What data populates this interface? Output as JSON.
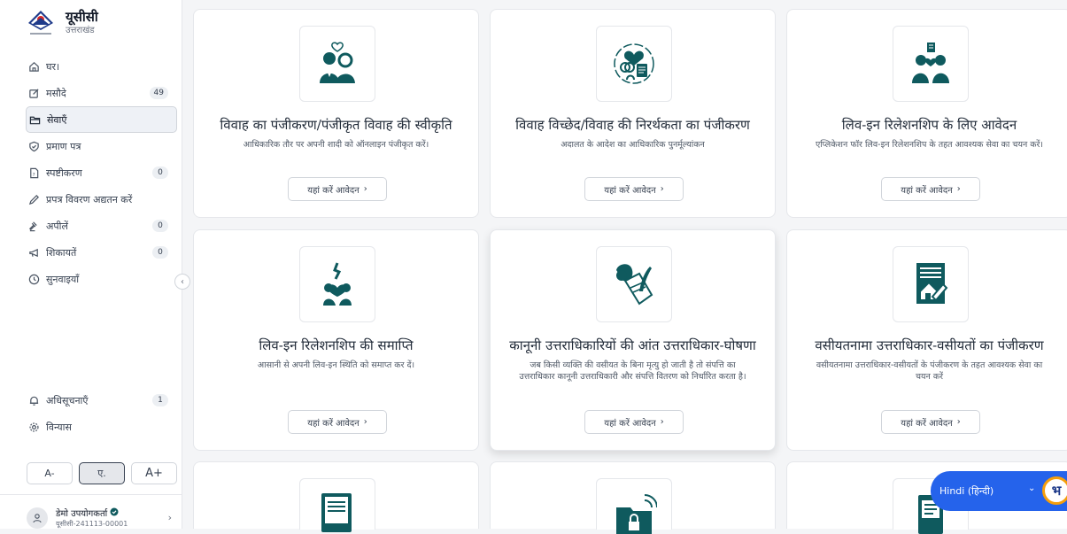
{
  "brand": {
    "title": "यूसीसी",
    "subtitle": "उत्तराखंड",
    "logo_icon": "uttarakhand-emblem-icon"
  },
  "sidebar": {
    "items": [
      {
        "label": "घर।",
        "icon": "home-icon",
        "badge": null
      },
      {
        "label": "मसौदे",
        "icon": "edit-icon",
        "badge": "49"
      },
      {
        "label": "सेवाएँ",
        "icon": "folder-icon",
        "badge": null,
        "active": true
      },
      {
        "label": "प्रमाण पत्र",
        "icon": "shield-check-icon",
        "badge": null
      },
      {
        "label": "स्पष्टीकरण",
        "icon": "document-question-icon",
        "badge": "0"
      },
      {
        "label": "प्रपत्र विवरण अद्यतन करें",
        "icon": "pencil-icon",
        "badge": null
      },
      {
        "label": "अपीलें",
        "icon": "gavel-icon",
        "badge": "0"
      },
      {
        "label": "शिकायतें",
        "icon": "megaphone-icon",
        "badge": "0"
      },
      {
        "label": "सुनवाइयाँ",
        "icon": "clock-icon",
        "badge": null
      }
    ],
    "bottom_items": [
      {
        "label": "अधिसूचनाएँ",
        "icon": "bell-icon",
        "badge": "1"
      },
      {
        "label": "विन्यास",
        "icon": "gear-icon",
        "badge": null
      }
    ],
    "font_controls": {
      "decrease": "A-",
      "normal": "ए.",
      "increase": "A+"
    },
    "user": {
      "name": "डेमो उपयोगकर्ता",
      "id": "यूसीसी-241113-00001"
    },
    "collapse_icon": "chevron-left-icon"
  },
  "apply_label": "यहां करें आवेदन",
  "cards": [
    {
      "title": "विवाह का पंजीकरण/पंजीकृत विवाह की स्वीकृति",
      "desc": "आधिकारिक तौर पर अपनी शादी को ऑनलाइन पंजीकृत करें।",
      "icon": "couple-heart-icon"
    },
    {
      "title": "विवाह विच्छेद/विवाह की निरर्थकता का पंजीकरण",
      "desc": "अदालत के आदेश का आधिकारिक पुनर्मूल्यांकन",
      "icon": "broken-heart-rings-icon"
    },
    {
      "title": "लिव-इन रिलेशनशिप के लिए आवेदन",
      "desc": "एप्लिकेशन फॉर लिव-इन रिलेशनशिप के तहत आवश्यक सेवा का चयन करें।",
      "icon": "couple-document-icon"
    },
    {
      "title": "लिव-इन रिलेशनशिप की समाप्ति",
      "desc": "आसानी से अपनी लिव-इन स्थिति को समाप्त कर दें।",
      "icon": "split-heart-icon"
    },
    {
      "title": "कानूनी उत्तराधिकारियों की आंत उत्तराधिकार-घोषणा",
      "desc": "जब किसी व्यक्ति की वसीयत के बिना मृत्यु हो जाती है तो संपत्ति का उत्तराधिकार कानूनी उत्तराधिकारी और संपत्ति वितरण को निर्धारित करता है।",
      "icon": "person-quill-document-icon"
    },
    {
      "title": "वसीयतनामा उत्तराधिकार-वसीयतों का पंजीकरण",
      "desc": "वसीयतनामा उत्तराधिकार-वसीयतों के पंजीकरण के तहत आवश्यक सेवा का चयन करें",
      "icon": "house-will-document-icon"
    }
  ],
  "partial_cards": [
    {
      "icon": "document-hand-icon"
    },
    {
      "icon": "folder-lock-signal-icon"
    },
    {
      "icon": "submit-form-icon"
    }
  ],
  "language": {
    "label": "Hindi (हिन्दी)",
    "logo": "भ",
    "icon": "chevron-down-icon"
  },
  "colors": {
    "accent": "#0f5a5e",
    "lang_blue": "#2563eb",
    "brand_orange": "#f59e0b"
  }
}
